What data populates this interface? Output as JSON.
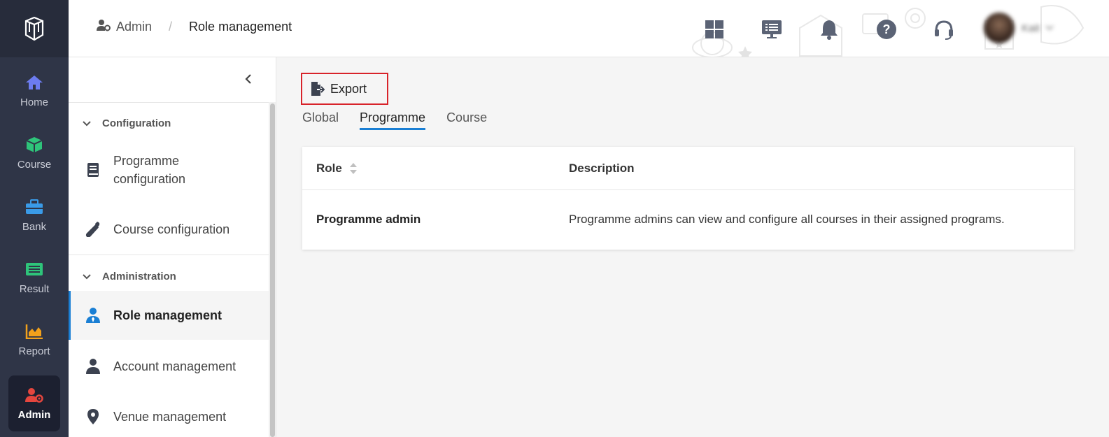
{
  "rail": {
    "items": [
      {
        "label": "Home",
        "icon": "home-icon",
        "color": "#6c7cf0"
      },
      {
        "label": "Course",
        "icon": "cube-icon",
        "color": "#2ec47a"
      },
      {
        "label": "Bank",
        "icon": "toolbox-icon",
        "color": "#3a9be8"
      },
      {
        "label": "Result",
        "icon": "list-icon",
        "color": "#2ec47a"
      },
      {
        "label": "Report",
        "icon": "area-chart-icon",
        "color": "#f2a11b"
      },
      {
        "label": "Admin",
        "icon": "user-gear-icon",
        "color": "#e5463e",
        "active": true
      }
    ]
  },
  "header": {
    "breadcrumb": {
      "parent": "Admin",
      "separator": "/",
      "current": "Role management"
    },
    "icons": [
      "grid-icon",
      "presentation-icon",
      "bell-icon",
      "help-icon",
      "headset-icon"
    ],
    "user": {
      "name": "Kait"
    }
  },
  "subnav": {
    "groups": [
      {
        "label": "Configuration",
        "items": [
          {
            "label": "Programme configuration",
            "icon": "book-icon"
          },
          {
            "label": "Course configuration",
            "icon": "wrench-icon"
          }
        ]
      },
      {
        "label": "Administration",
        "items": [
          {
            "label": "Role management",
            "icon": "user-tie-icon",
            "active": true
          },
          {
            "label": "Account management",
            "icon": "user-icon"
          },
          {
            "label": "Venue management",
            "icon": "location-pin-icon"
          }
        ]
      }
    ]
  },
  "main": {
    "export_label": "Export",
    "tabs": [
      {
        "label": "Global"
      },
      {
        "label": "Programme",
        "active": true
      },
      {
        "label": "Course"
      }
    ],
    "table": {
      "columns": [
        "Role",
        "Description"
      ],
      "rows": [
        {
          "role": "Programme admin",
          "description": "Programme admins can view and configure all courses in their assigned programs."
        }
      ]
    }
  },
  "colors": {
    "accent": "#1a7fd4",
    "highlight_border": "#d8232a",
    "rail_bg": "#2f3547"
  }
}
